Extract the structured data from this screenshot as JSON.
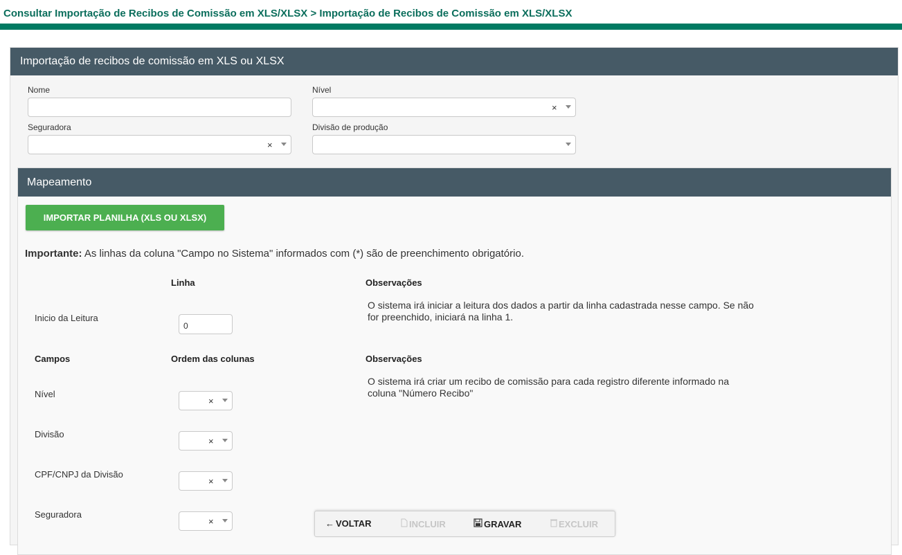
{
  "breadcrumb": "Consultar Importação de Recibos de Comissão em XLS/XLSX > Importação de Recibos de Comissão em XLS/XLSX",
  "colors": {
    "accent": "#007a62",
    "header": "#465a66",
    "button": "#4caf50"
  },
  "panel": {
    "title": "Importação de recibos de comissão em XLS ou XLSX",
    "fields": {
      "nome_label": "Nome",
      "nome_value": "",
      "nivel_label": "Nível",
      "seguradora_label": "Seguradora",
      "divisao_label": "Divisão de produção",
      "clear_glyph": "×"
    }
  },
  "mapping": {
    "title": "Mapeamento",
    "import_button": "IMPORTAR PLANILHA (XLS OU XLSX)",
    "important_bold": "Importante:",
    "important_text": " As linhas da coluna \"Campo no Sistema\" informados com (*) são de preenchimento obrigatório.",
    "linha_header": "Linha",
    "obs_header": "Observações",
    "inicio_label": "Inicio da Leitura",
    "inicio_value": "0",
    "inicio_obs": "O sistema irá iniciar a leitura dos dados a partir da linha cadastrada nesse campo. Se não for preenchido, iniciará na linha 1.",
    "campos_header": "Campos",
    "ordem_header": "Ordem das colunas",
    "obs_header2": "Observações",
    "campos_obs": "O sistema irá criar um recibo de comissão para cada registro diferente informado na coluna \"Número Recibo\"",
    "rows": [
      {
        "label": "Nível"
      },
      {
        "label": "Divisão"
      },
      {
        "label": "CPF/CNPJ da Divisão"
      },
      {
        "label": "Seguradora"
      }
    ]
  },
  "toolbar": {
    "voltar": "VOLTAR",
    "incluir": "INCLUIR",
    "gravar": "GRAVAR",
    "excluir": "EXCLUIR",
    "icons": {
      "voltar": "arrow-left-icon",
      "incluir": "file-icon",
      "gravar": "save-icon",
      "excluir": "trash-icon"
    }
  }
}
